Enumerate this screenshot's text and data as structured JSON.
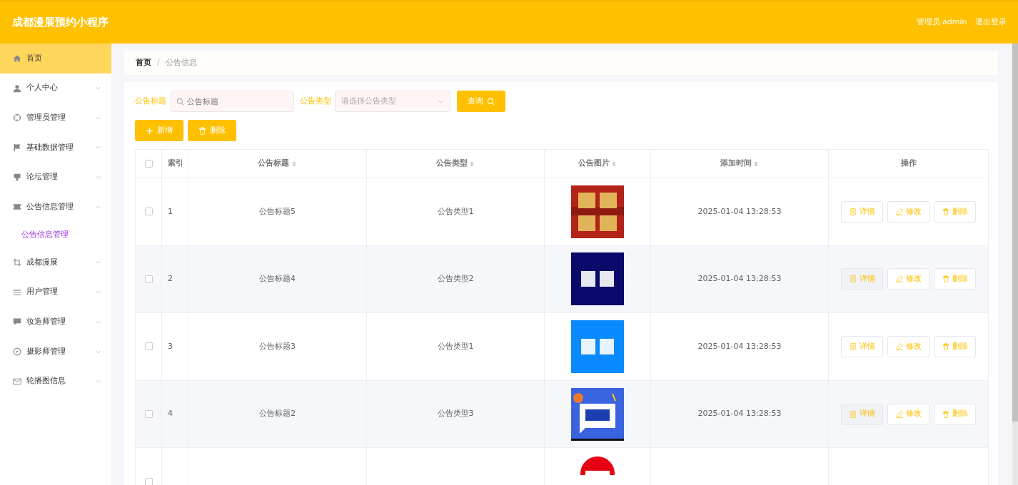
{
  "header": {
    "title": "成都漫展预约小程序",
    "user": "管理员 admin",
    "logout": "退出登录"
  },
  "sidebar": {
    "items": [
      {
        "label": "首页",
        "selected": true
      },
      {
        "label": "个人中心",
        "selected": false,
        "expanded": false
      },
      {
        "label": "管理员管理",
        "selected": false,
        "expanded": false
      },
      {
        "label": "基础数据管理",
        "selected": false,
        "expanded": false
      },
      {
        "label": "论坛管理",
        "selected": false,
        "expanded": false
      },
      {
        "label": "公告信息管理",
        "selected": false,
        "expanded": true,
        "children": [
          {
            "label": "公告信息管理",
            "selected": true
          }
        ]
      },
      {
        "label": "成都漫展",
        "selected": false,
        "expanded": false
      },
      {
        "label": "用户管理",
        "selected": false,
        "expanded": false
      },
      {
        "label": "妆造师管理",
        "selected": false,
        "expanded": false
      },
      {
        "label": "摄影师管理",
        "selected": false,
        "expanded": false
      },
      {
        "label": "轮播图信息",
        "selected": false,
        "expanded": false
      }
    ]
  },
  "breadcrumb": {
    "items": [
      "首页",
      "公告信息"
    ],
    "separator": "/"
  },
  "filters": {
    "title_label": "公告标题",
    "title_placeholder": "公告标题",
    "type_label": "公告类型",
    "type_placeholder": "请选择公告类型",
    "search_button": "查询"
  },
  "actions": [
    "新增",
    "删除"
  ],
  "table": {
    "select_all_checked": false,
    "columns": [
      {
        "label": "索引",
        "sortable": false
      },
      {
        "label": "公告标题",
        "sortable": true
      },
      {
        "label": "公告类型",
        "sortable": true
      },
      {
        "label": "公告图片",
        "sortable": true
      },
      {
        "label": "添加时间",
        "sortable": true
      },
      {
        "label": "操作",
        "sortable": false
      }
    ],
    "rows": [
      {
        "index": "1",
        "title": "公告标题5",
        "type": "公告类型1",
        "time": "2025-01-04 13:28:53",
        "checked": false,
        "actions": [
          "详情",
          "修改",
          "删除"
        ]
      },
      {
        "index": "2",
        "title": "公告标题4",
        "type": "公告类型2",
        "time": "2025-01-04 13:28:53",
        "checked": false,
        "actions": [
          "详情",
          "修改",
          "删除"
        ]
      },
      {
        "index": "3",
        "title": "公告标题3",
        "type": "公告类型1",
        "time": "2025-01-04 13:28:53",
        "checked": false,
        "actions": [
          "详情",
          "修改",
          "删除"
        ]
      },
      {
        "index": "4",
        "title": "公告标题2",
        "type": "公告类型3",
        "time": "2025-01-04 13:28:53",
        "checked": false,
        "actions": [
          "详情",
          "修改",
          "删除"
        ]
      },
      {
        "checked": false
      }
    ]
  }
}
